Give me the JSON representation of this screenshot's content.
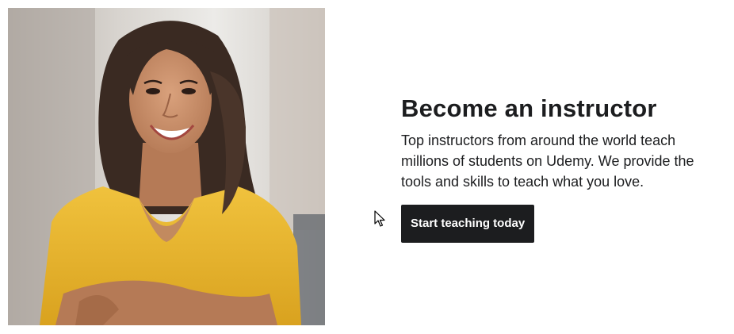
{
  "instructor_promo": {
    "title": "Become an instructor",
    "description": "Top instructors from around the world teach millions of students on Udemy. We provide the tools and skills to teach what you love.",
    "cta_label": "Start teaching today"
  },
  "image": {
    "subject": "smiling woman in yellow top with arms crossed"
  },
  "colors": {
    "text_primary": "#1c1d1f",
    "button_bg": "#1c1d1f",
    "button_text": "#ffffff",
    "shirt": "#e8b430"
  },
  "icons": {
    "cursor": "mouse-pointer-icon"
  }
}
